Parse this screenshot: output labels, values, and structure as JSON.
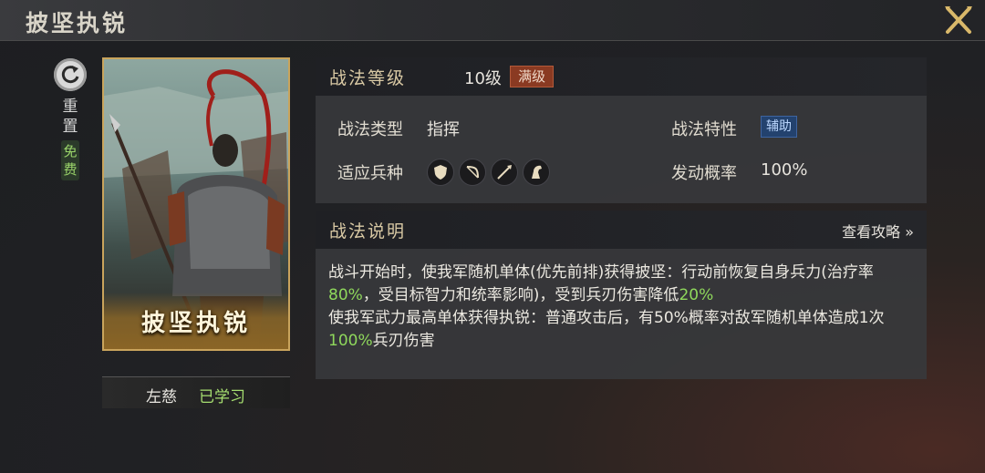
{
  "header": {
    "title": "披坚执锐"
  },
  "left": {
    "reset_label": "重置",
    "free_label": "免费",
    "card_name": "披坚执锐",
    "learner_name": "左慈",
    "learned_status": "已学习"
  },
  "level_panel": {
    "title": "战法等级",
    "level": "10级",
    "max_badge": "满级"
  },
  "info": {
    "type_label": "战法类型",
    "type_value": "指挥",
    "trait_label": "战法特性",
    "trait_value": "辅助",
    "troops_label": "适应兵种",
    "troop_icons": [
      "shield-icon",
      "bow-icon",
      "spear-icon",
      "horse-icon"
    ],
    "prob_label": "发动概率",
    "prob_value": "100%"
  },
  "desc_panel": {
    "title": "战法说明",
    "guide_link": "查看攻略 »",
    "parts": [
      "战斗开始时，使我军随机单体(优先前排)获得披坚：行动前恢复自身兵力(治疗率",
      "80%",
      "，受目标智力和统率影响)，受到兵刃伤害降低",
      "20%",
      "使我军武力最高单体获得执锐：普通攻击后，有50%概率对敌军随机单体造成1次",
      "100%",
      "兵刃伤害"
    ]
  }
}
